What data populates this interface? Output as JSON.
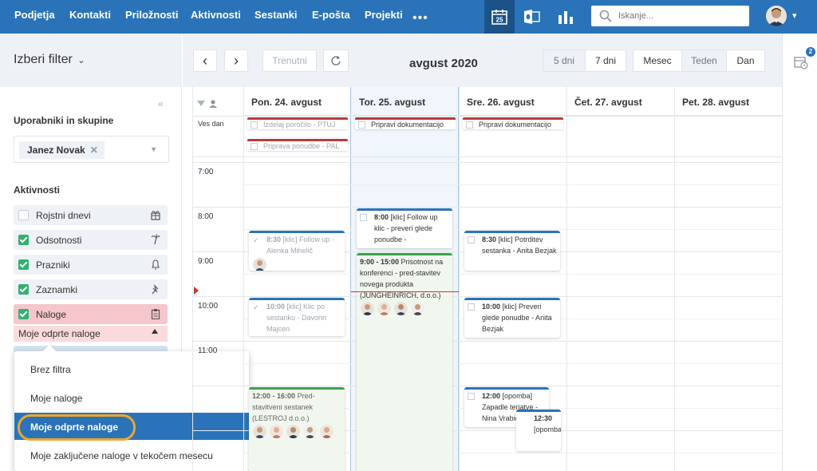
{
  "topnav": {
    "items": [
      "Podjetja",
      "Kontakti",
      "Priložnosti",
      "Aktivnosti",
      "Sestanki",
      "E-pošta",
      "Projekti"
    ],
    "more": "•••",
    "calendar_day": "25",
    "search_placeholder": "Iskanje..."
  },
  "filter": {
    "title": "Izberi filter",
    "users_title": "Uporabniki in skupine",
    "user_chip": "Janez Novak",
    "user_chip_remove": "✕",
    "activities_title": "Aktivnosti",
    "activities": [
      {
        "label": "Rojstni dnevi",
        "checked": false,
        "icon": "gift-icon"
      },
      {
        "label": "Odsotnosti",
        "checked": true,
        "icon": "palm-icon"
      },
      {
        "label": "Prazniki",
        "checked": true,
        "icon": "bell-icon"
      },
      {
        "label": "Zaznamki",
        "checked": true,
        "icon": "pin-icon"
      },
      {
        "label": "Naloge",
        "checked": true,
        "icon": "clipboard-icon"
      }
    ],
    "subfilter": "Moje odprte naloge"
  },
  "dropdown": {
    "options": [
      "Brez filtra",
      "Moje naloge",
      "Moje odprte naloge",
      "Moje zaključene naloge v tekočem mesecu"
    ],
    "selected": "Moje odprte naloge"
  },
  "toolbar": {
    "prev": "‹",
    "next": "›",
    "today": "Trenutni",
    "title": "avgust 2020",
    "days": [
      "5 dni",
      "7 dni"
    ],
    "days_active": "5 dni",
    "views": [
      "Mesec",
      "Teden",
      "Dan"
    ],
    "views_active": "Teden"
  },
  "rail": {
    "badge": "2"
  },
  "calendar": {
    "days": [
      "Pon. 24. avgust",
      "Tor. 25. avgust",
      "Sre. 26. avgust",
      "Čet. 27. avgust",
      "Pet. 28. avgust"
    ],
    "today_index": 1,
    "allday_label": "Ves dan",
    "hours": [
      "7:00",
      "8:00",
      "9:00",
      "10:00",
      "11:00"
    ],
    "allday_events": [
      {
        "day": 0,
        "row": 0,
        "text": "Izdelaj poročilo - PTUJ",
        "done": true
      },
      {
        "day": 0,
        "row": 1,
        "text": "Priprava ponudbe - PAL",
        "done": true
      },
      {
        "day": 1,
        "row": 0,
        "text": "Pripravi dokumentacijo",
        "done": false
      },
      {
        "day": 2,
        "row": 0,
        "text": "Pripravi dokumentacijo",
        "done": false
      }
    ],
    "events": [
      {
        "id": "ev-mon-830",
        "time": "8:30",
        "text": "[klic] Follow up - Alenka Mihelič",
        "done": true
      },
      {
        "id": "ev-mon-1000",
        "time": "10:00",
        "text": "[klic] Klic po sestanku - Davorin Majcen",
        "done": true
      },
      {
        "id": "ev-mon-1200",
        "time": "12:00 - 16:00",
        "text": "Pred-stavitveni sestanek (LESTROJ d.o.o.)"
      },
      {
        "id": "ev-tue-800",
        "time": "8:00",
        "text": "[klic] Follow up klic - preveri glede ponudbe -"
      },
      {
        "id": "ev-tue-900",
        "time": "9:00 - 15:00",
        "text": "Prisotnost na konferenci - pred-stavitev novega produkta (JUNGHEINRICH, d.o.o.)"
      },
      {
        "id": "ev-wed-830",
        "time": "8:30",
        "text": "[klic] Potrditev sestanka - Anita Bezjak"
      },
      {
        "id": "ev-wed-1000",
        "time": "10:00",
        "text": "[klic] Preveri glede ponudbe - Anita Bezjak"
      },
      {
        "id": "ev-wed-1200",
        "time": "12:00",
        "text": "[opomba] Zapadle terjatve - Nina Vrabič"
      },
      {
        "id": "ev-wed-1230",
        "time": "12:30",
        "text": "[opomba]"
      }
    ]
  }
}
